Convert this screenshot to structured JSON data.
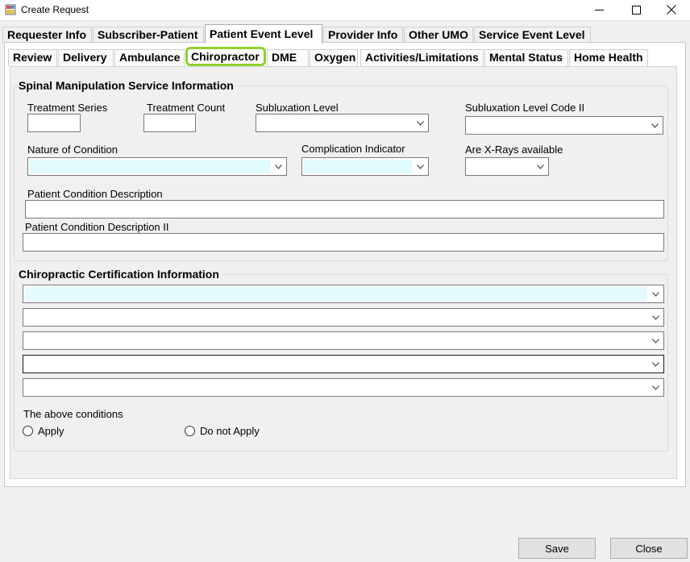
{
  "window": {
    "title": "Create Request"
  },
  "main_tabs": [
    {
      "label": "Requester Info"
    },
    {
      "label": "Subscriber-Patient"
    },
    {
      "label": "Patient Event Level",
      "active": true
    },
    {
      "label": "Provider Info"
    },
    {
      "label": "Other UMO"
    },
    {
      "label": "Service Event Level"
    }
  ],
  "sub_tabs": [
    {
      "label": "Review"
    },
    {
      "label": "Delivery"
    },
    {
      "label": "Ambulance"
    },
    {
      "label": "Chiropractor",
      "active": true
    },
    {
      "label": "DME"
    },
    {
      "label": "Oxygen"
    },
    {
      "label": "Activities/Limitations"
    },
    {
      "label": "Mental Status"
    },
    {
      "label": "Home Health"
    }
  ],
  "spinal": {
    "title": "Spinal Manipulation Service Information",
    "treatment_series": {
      "label": "Treatment Series",
      "value": ""
    },
    "treatment_count": {
      "label": "Treatment Count",
      "value": ""
    },
    "subluxation_level": {
      "label": "Subluxation Level",
      "value": ""
    },
    "subluxation_level_code_2": {
      "label": "Subluxation Level Code II",
      "value": ""
    },
    "nature_of_condition": {
      "label": "Nature of Condition",
      "value": ""
    },
    "complication_indicator": {
      "label": "Complication Indicator",
      "value": ""
    },
    "xrays_available": {
      "label": "Are X-Rays available",
      "value": ""
    },
    "patient_condition_desc": {
      "label": "Patient Condition Description",
      "value": ""
    },
    "patient_condition_desc_2": {
      "label": "Patient Condition Description II",
      "value": ""
    }
  },
  "certification": {
    "title": "Chiropractic Certification Information",
    "conditions": [
      "",
      "",
      "",
      "",
      ""
    ],
    "above_conditions_label": "The above conditions",
    "apply_label": "Apply",
    "not_apply_label": "Do not Apply"
  },
  "footer": {
    "save_label": "Save",
    "close_label": "Close"
  },
  "colors": {
    "highlight_border": "#8fd12f",
    "required_field": "#e1fbff"
  }
}
